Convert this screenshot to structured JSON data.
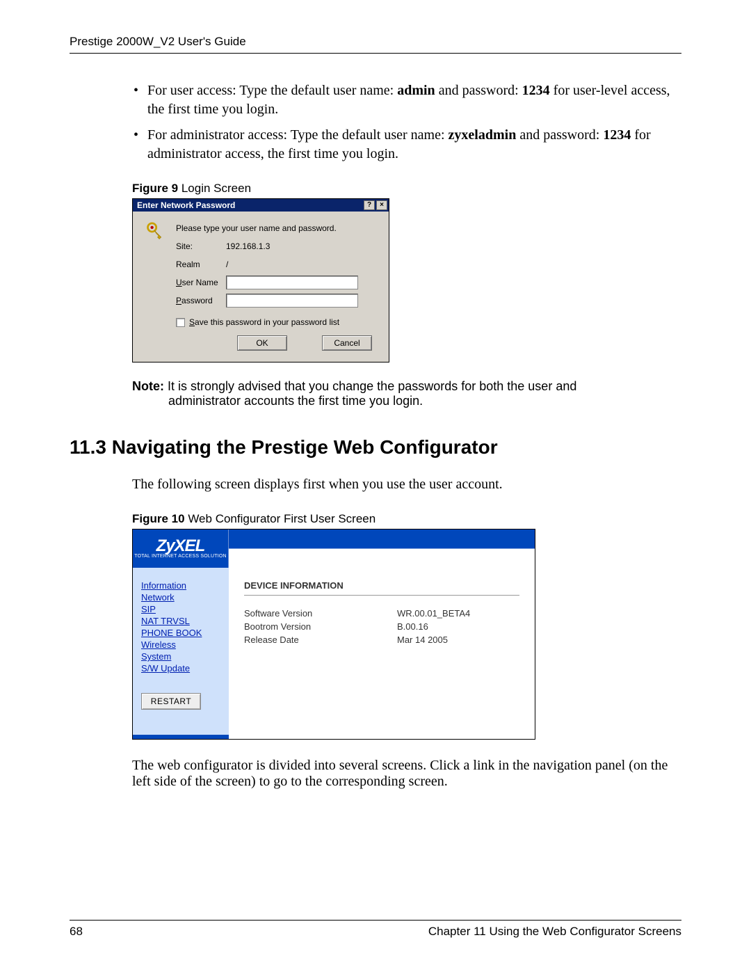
{
  "header": {
    "left": "Prestige 2000W_V2 User's Guide"
  },
  "bullets": {
    "user_prefix": "For user access: Type the default user name: ",
    "user_admin": "admin",
    "user_mid": " and password: ",
    "user_pw": "1234",
    "user_suffix": " for user-level access, the first time you login.",
    "admin_prefix": "For administrator access: Type the default user name: ",
    "admin_name": "zyxeladmin",
    "admin_mid": " and password: ",
    "admin_pw": "1234",
    "admin_suffix": " for administrator access, the first time you login."
  },
  "fig9": {
    "caption_bold": "Figure 9",
    "caption_rest": "   Login Screen",
    "title": "Enter Network Password",
    "help_btn": "?",
    "close_btn": "×",
    "prompt": "Please type your user name and password.",
    "labels": {
      "site": "Site:",
      "realm": "Realm",
      "user": "User Name",
      "pass": "Password"
    },
    "values": {
      "site": "192.168.1.3",
      "realm": "/"
    },
    "save_label": "Save this password in your password list",
    "ok": "OK",
    "cancel": "Cancel"
  },
  "note": {
    "bold": "Note:",
    "line1": " It is strongly advised that you change the passwords for both the user and",
    "line2": "administrator accounts the first time you login."
  },
  "section": {
    "heading": "11.3  Navigating the Prestige Web Configurator"
  },
  "para1": "The following screen displays first when you use the user account.",
  "fig10": {
    "caption_bold": "Figure 10",
    "caption_rest": "   Web Configurator First User Screen",
    "logo": "ZyXEL",
    "logo_sub": "TOTAL INTERNET ACCESS SOLUTION",
    "nav": [
      "Information",
      "Network",
      "SIP",
      "NAT TRVSL",
      "PHONE BOOK",
      "Wireless",
      "System",
      "S/W Update"
    ],
    "restart": "RESTART",
    "panel_title": "DEVICE INFORMATION",
    "rows": [
      {
        "k": "Software Version",
        "v": "WR.00.01_BETA4"
      },
      {
        "k": "Bootrom Version",
        "v": "B.00.16"
      },
      {
        "k": "Release Date",
        "v": "Mar 14 2005"
      }
    ]
  },
  "para2": "The web configurator is divided into several screens. Click a link in the navigation panel (on the left side of the screen) to go to the corresponding screen.",
  "footer": {
    "page": "68",
    "chapter": "Chapter 11 Using the Web Configurator Screens"
  }
}
